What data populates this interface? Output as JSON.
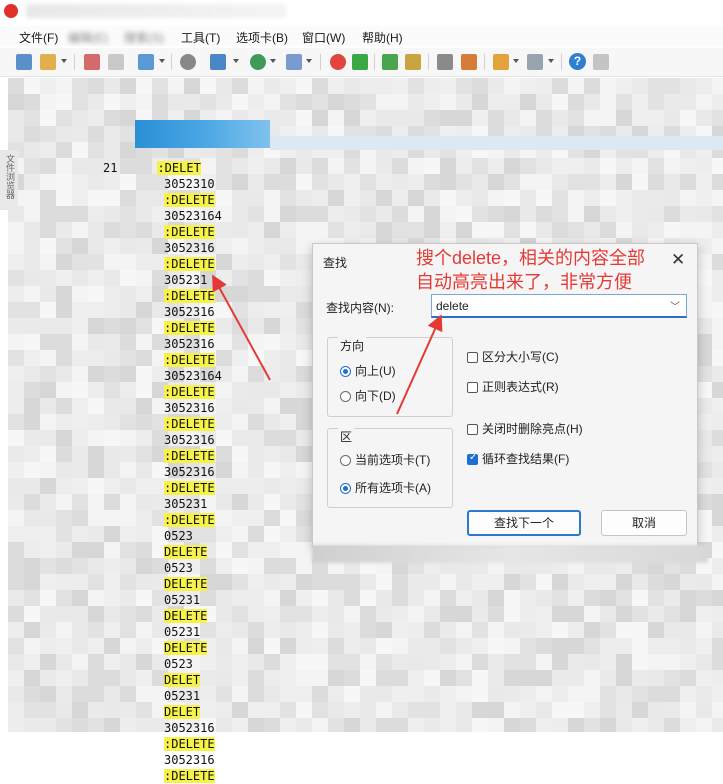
{
  "menubar": {
    "items": [
      "文件(F)",
      "编辑(E)",
      "搜索(S)",
      "工具(T)",
      "选项卡(B)",
      "窗口(W)",
      "帮助(H)"
    ]
  },
  "toolbar": {
    "icons": [
      "new-file-icon",
      "open-folder-icon",
      "save-icon",
      "copy-icon",
      "paste-icon",
      "find-icon",
      "replace-icon",
      "globe-icon",
      "font-icon",
      "target-icon",
      "plugin-icon",
      "fullscreen-icon",
      "lock-icon",
      "keyboard-icon",
      "edit-icon",
      "add-tab-icon",
      "layout-icon",
      "help-icon",
      "comment-icon"
    ],
    "help_glyph": "?"
  },
  "side_panel": {
    "label": "文件浏览器"
  },
  "log": {
    "lines": [
      {
        "prefix": "21",
        "code": ":DELET",
        "hl": true
      },
      {
        "prefix": "",
        "code": "3052310",
        "hl": false
      },
      {
        "prefix": "",
        "code": ":DELETE",
        "hl": true
      },
      {
        "prefix": "",
        "code": "30523164",
        "hl": false
      },
      {
        "prefix": "",
        "code": ":DELETE",
        "hl": true
      },
      {
        "prefix": "",
        "code": "3052316",
        "hl": false
      },
      {
        "prefix": "",
        "code": ":DELETE",
        "hl": true
      },
      {
        "prefix": "",
        "code": "305231",
        "hl": false
      },
      {
        "prefix": "",
        "code": ":DELETE",
        "hl": true
      },
      {
        "prefix": "",
        "code": "3052316",
        "hl": false
      },
      {
        "prefix": "",
        "code": ":DELETE",
        "hl": true
      },
      {
        "prefix": "",
        "code": "3052316",
        "hl": false
      },
      {
        "prefix": "",
        "code": ":DELETE",
        "hl": true
      },
      {
        "prefix": "",
        "code": "30523164",
        "hl": false
      },
      {
        "prefix": "",
        "code": ":DELETE",
        "hl": true
      },
      {
        "prefix": "",
        "code": "3052316",
        "hl": false
      },
      {
        "prefix": "",
        "code": ":DELETE",
        "hl": true
      },
      {
        "prefix": "",
        "code": "3052316",
        "hl": false
      },
      {
        "prefix": "",
        "code": ":DELETE",
        "hl": true
      },
      {
        "prefix": "",
        "code": "3052316",
        "hl": false
      },
      {
        "prefix": "",
        "code": ":DELETE",
        "hl": true
      },
      {
        "prefix": "",
        "code": "305231",
        "hl": false
      },
      {
        "prefix": "",
        "code": ":DELETE",
        "hl": true
      },
      {
        "prefix": "",
        "code": "0523",
        "hl": false
      },
      {
        "prefix": "",
        "code": "DELETE",
        "hl": true
      },
      {
        "prefix": "",
        "code": "0523",
        "hl": false
      },
      {
        "prefix": "",
        "code": "DELETE",
        "hl": true
      },
      {
        "prefix": "",
        "code": "05231",
        "hl": false
      },
      {
        "prefix": "",
        "code": "DELETE",
        "hl": true
      },
      {
        "prefix": "",
        "code": "05231",
        "hl": false
      },
      {
        "prefix": "",
        "code": "DELETE",
        "hl": true
      },
      {
        "prefix": "",
        "code": "0523",
        "hl": false
      },
      {
        "prefix": "",
        "code": "DELET",
        "hl": true
      },
      {
        "prefix": "",
        "code": "05231",
        "hl": false
      },
      {
        "prefix": "",
        "code": "DELET",
        "hl": true
      },
      {
        "prefix": "",
        "code": "3052316",
        "hl": false
      },
      {
        "prefix": "",
        "code": ":DELETE",
        "hl": true
      },
      {
        "prefix": "",
        "code": "3052316",
        "hl": false
      },
      {
        "prefix": "",
        "code": ":DELETE",
        "hl": true
      }
    ]
  },
  "find_dialog": {
    "title": "查找",
    "close_glyph": "✕",
    "find_label": "查找内容(N):",
    "find_value": "delete",
    "dropdown_glyph": "﹀",
    "direction": {
      "legend": "方向",
      "options": [
        {
          "label": "向上(U)",
          "selected": true
        },
        {
          "label": "向下(D)",
          "selected": false
        }
      ]
    },
    "scope": {
      "legend": "区",
      "options": [
        {
          "label": "当前选项卡(T)",
          "selected": false
        },
        {
          "label": "所有选项卡(A)",
          "selected": true
        }
      ]
    },
    "options": [
      {
        "label": "区分大小写(C)",
        "checked": false
      },
      {
        "label": "正则表达式(R)",
        "checked": false
      },
      {
        "label": "关闭时删除亮点(H)",
        "checked": false
      },
      {
        "label": "循环查找结果(F)",
        "checked": true
      }
    ],
    "find_next_label": "查找下一个",
    "cancel_label": "取消"
  },
  "annotation": {
    "line1": "搜个delete，相关的内容全部",
    "line2": "自动高亮出来了，非常方便",
    "color": "#e43a36"
  },
  "colors": {
    "highlight": "#f6f24a",
    "accent": "#1e6fcf",
    "tab_active": "#2a8fd6"
  }
}
